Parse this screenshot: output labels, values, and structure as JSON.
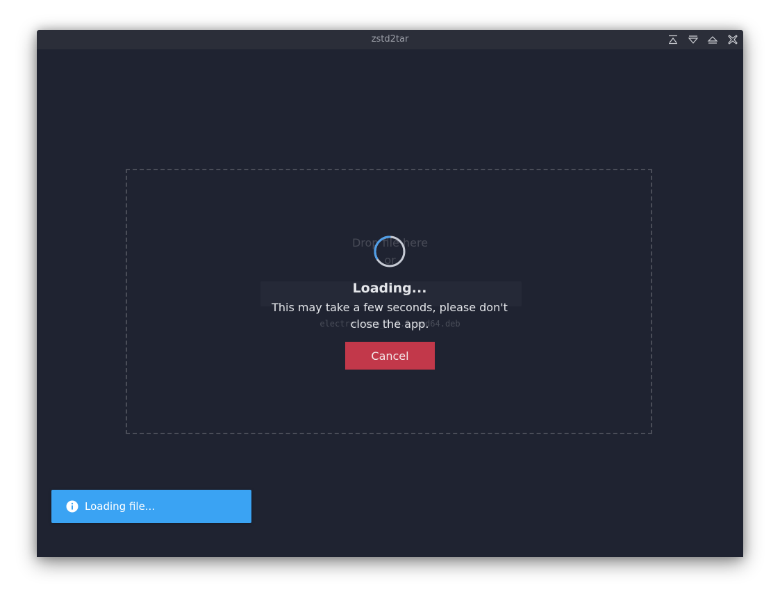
{
  "window": {
    "title": "zstd2tar",
    "controls": [
      "keep-above-icon",
      "minimize-icon",
      "maximize-icon",
      "close-icon"
    ]
  },
  "dropzone": {
    "line1": "Drop file here",
    "line2": "or",
    "file_text": "electron-app_1.0.0_amd64.deb"
  },
  "loading": {
    "title": "Loading...",
    "message_line1": "This may take a few seconds, please don't",
    "message_line2": "close the app.",
    "cancel_label": "Cancel",
    "spinner_icon": "spinner-icon"
  },
  "toast": {
    "icon": "info-icon",
    "text": "Loading file..."
  },
  "colors": {
    "background": "#1f2331",
    "titlebar": "#2b2e39",
    "cancel": "#c2384a",
    "toast": "#3aa3f3",
    "spinner": "#4f9ee8"
  }
}
